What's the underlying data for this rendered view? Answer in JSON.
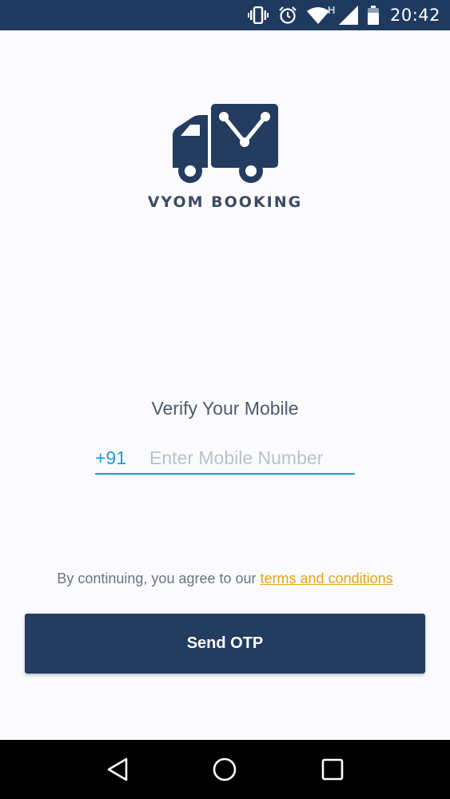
{
  "status_bar": {
    "time": "20:42",
    "network_label": "H",
    "icons": [
      "vibrate-icon",
      "alarm-icon",
      "wifi-icon",
      "cellular-signal-icon",
      "battery-icon"
    ]
  },
  "logo": {
    "text": "VYOM BOOKING",
    "icon": "delivery-truck-icon"
  },
  "verify": {
    "title": "Verify Your Mobile",
    "country_code": "+91",
    "mobile_placeholder": "Enter Mobile Number",
    "mobile_value": ""
  },
  "terms": {
    "prefix": "By continuing, you agree to our ",
    "link_label": "terms and conditions"
  },
  "actions": {
    "send_otp_label": "Send OTP"
  },
  "nav_bar": {
    "buttons": [
      "back-icon",
      "home-icon",
      "recents-icon"
    ]
  },
  "colors": {
    "primary": "#233c60",
    "status_bar": "#1f3a5f",
    "accent": "#1e9bd8",
    "link": "#e8a317"
  }
}
